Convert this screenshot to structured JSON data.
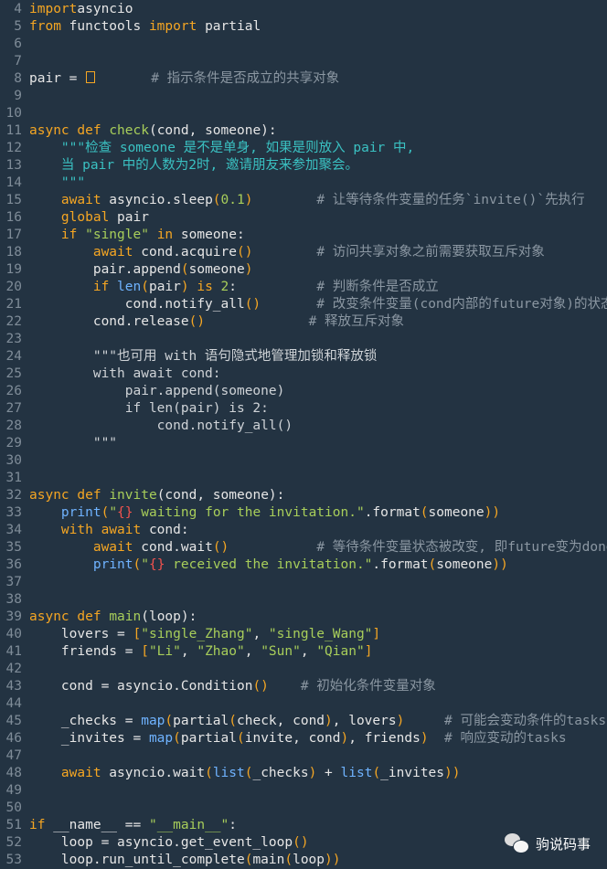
{
  "lines": [
    {
      "n": "4",
      "t": [
        [
          "kw",
          "import"
        ],
        [
          "",
          "asyncio"
        ]
      ],
      "sep": [
        0,
        " "
      ]
    },
    {
      "n": "5",
      "t": [
        [
          "kw",
          "from"
        ],
        [
          "",
          " functools "
        ],
        [
          "kw",
          "import"
        ],
        [
          "",
          " partial"
        ]
      ]
    },
    {
      "n": "6",
      "t": []
    },
    {
      "n": "7",
      "t": []
    },
    {
      "n": "8",
      "t": [
        [
          "",
          "pair = "
        ],
        [
          "box",
          ""
        ],
        [
          "",
          "       "
        ],
        [
          "cm",
          "# 指示条件是否成立的共享对象"
        ]
      ]
    },
    {
      "n": "9",
      "t": []
    },
    {
      "n": "10",
      "t": []
    },
    {
      "n": "11",
      "t": [
        [
          "kw",
          "async def "
        ],
        [
          "fn",
          "check"
        ],
        [
          "",
          "(cond, someone):"
        ]
      ]
    },
    {
      "n": "12",
      "t": [
        [
          "ds",
          "    \"\"\"检查 someone 是不是单身, 如果是则放入 pair 中,"
        ]
      ]
    },
    {
      "n": "13",
      "t": [
        [
          "ds",
          "    当 pair 中的人数为2时, 邀请朋友来参加聚会。"
        ]
      ]
    },
    {
      "n": "14",
      "t": [
        [
          "ds",
          "    \"\"\""
        ]
      ]
    },
    {
      "n": "15",
      "t": [
        [
          "kw",
          "    await"
        ],
        [
          "",
          " asyncio.sleep"
        ],
        [
          "pa",
          "("
        ],
        [
          "nm",
          "0.1"
        ],
        [
          "pa",
          ")"
        ],
        [
          "",
          "        "
        ],
        [
          "cm",
          "# 让等待条件变量的任务`invite()`先执行"
        ]
      ]
    },
    {
      "n": "16",
      "t": [
        [
          "kw",
          "    global"
        ],
        [
          "",
          " pair"
        ]
      ]
    },
    {
      "n": "17",
      "t": [
        [
          "kw",
          "    if"
        ],
        [
          "st",
          " \"single\""
        ],
        [
          "kw",
          " in"
        ],
        [
          "",
          " someone:"
        ]
      ]
    },
    {
      "n": "18",
      "t": [
        [
          "kw",
          "        await"
        ],
        [
          "",
          " cond.acquire"
        ],
        [
          "pa",
          "()"
        ],
        [
          "",
          "        "
        ],
        [
          "cm",
          "# 访问共享对象之前需要获取互斥对象"
        ]
      ]
    },
    {
      "n": "19",
      "t": [
        [
          "",
          "        pair.append"
        ],
        [
          "pa",
          "("
        ],
        [
          "",
          "someone"
        ],
        [
          "pa",
          ")"
        ]
      ]
    },
    {
      "n": "20",
      "t": [
        [
          "kw",
          "        if"
        ],
        [
          " call",
          " len"
        ],
        [
          "pa",
          "("
        ],
        [
          "",
          "pair"
        ],
        [
          "pa",
          ")"
        ],
        [
          "kw",
          " is"
        ],
        [
          "nm",
          " 2"
        ],
        [
          "",
          ":"
        ],
        [
          "",
          "          "
        ],
        [
          "cm",
          "# 判断条件是否成立"
        ]
      ]
    },
    {
      "n": "21",
      "t": [
        [
          "",
          "            cond.notify_all"
        ],
        [
          "pa",
          "()"
        ],
        [
          "",
          "       "
        ],
        [
          "cm",
          "# 改变条件变量(cond内部的future对象)的状态"
        ]
      ]
    },
    {
      "n": "22",
      "t": [
        [
          "",
          "        cond.release"
        ],
        [
          "pa",
          "()"
        ],
        [
          "",
          "             "
        ],
        [
          "cm",
          "# 释放互斥对象"
        ]
      ]
    },
    {
      "n": "23",
      "t": []
    },
    {
      "n": "24",
      "t": [
        [
          "db",
          "        \"\"\"也可用 with 语句隐式地管理加锁和释放锁"
        ]
      ]
    },
    {
      "n": "25",
      "t": [
        [
          "db",
          "        with await cond:"
        ]
      ]
    },
    {
      "n": "26",
      "t": [
        [
          "db",
          "            pair.append(someone)"
        ]
      ]
    },
    {
      "n": "27",
      "t": [
        [
          "db",
          "            if len(pair) is 2:"
        ]
      ]
    },
    {
      "n": "28",
      "t": [
        [
          "db",
          "                cond.notify_all()"
        ]
      ]
    },
    {
      "n": "29",
      "t": [
        [
          "db",
          "        \"\"\""
        ]
      ]
    },
    {
      "n": "30",
      "t": []
    },
    {
      "n": "31",
      "t": []
    },
    {
      "n": "32",
      "t": [
        [
          "kw",
          "async def "
        ],
        [
          "fn",
          "invite"
        ],
        [
          "",
          "(cond, someone):"
        ]
      ]
    },
    {
      "n": "33",
      "t": [
        [
          "call",
          "    print"
        ],
        [
          "pa",
          "("
        ],
        [
          "st",
          "\""
        ],
        [
          "sp",
          "{}"
        ],
        [
          "st",
          " waiting for the invitation.\""
        ],
        [
          "",
          ".format"
        ],
        [
          "pa",
          "("
        ],
        [
          "",
          "someone"
        ],
        [
          "pa",
          "))"
        ]
      ]
    },
    {
      "n": "34",
      "t": [
        [
          "kw",
          "    with await"
        ],
        [
          "",
          " cond:"
        ]
      ]
    },
    {
      "n": "35",
      "t": [
        [
          "kw",
          "        await"
        ],
        [
          "",
          " cond.wait"
        ],
        [
          "pa",
          "()"
        ],
        [
          "",
          "           "
        ],
        [
          "cm",
          "# 等待条件变量状态被改变, 即future变为done"
        ]
      ]
    },
    {
      "n": "36",
      "t": [
        [
          "call",
          "        print"
        ],
        [
          "pa",
          "("
        ],
        [
          "st",
          "\""
        ],
        [
          "sp",
          "{}"
        ],
        [
          "st",
          " received the invitation.\""
        ],
        [
          "",
          ".format"
        ],
        [
          "pa",
          "("
        ],
        [
          "",
          "someone"
        ],
        [
          "pa",
          "))"
        ]
      ]
    },
    {
      "n": "37",
      "t": []
    },
    {
      "n": "38",
      "t": []
    },
    {
      "n": "39",
      "t": [
        [
          "kw",
          "async def "
        ],
        [
          "fn",
          "main"
        ],
        [
          "",
          "(loop):"
        ]
      ]
    },
    {
      "n": "40",
      "t": [
        [
          "",
          "    lovers = "
        ],
        [
          "pa",
          "["
        ],
        [
          "st",
          "\"single_Zhang\""
        ],
        [
          "",
          ", "
        ],
        [
          "st",
          "\"single_Wang\""
        ],
        [
          "pa",
          "]"
        ]
      ]
    },
    {
      "n": "41",
      "t": [
        [
          "",
          "    friends = "
        ],
        [
          "pa",
          "["
        ],
        [
          "st",
          "\"Li\""
        ],
        [
          "",
          ", "
        ],
        [
          "st",
          "\"Zhao\""
        ],
        [
          "",
          ", "
        ],
        [
          "st",
          "\"Sun\""
        ],
        [
          "",
          ", "
        ],
        [
          "st",
          "\"Qian\""
        ],
        [
          "pa",
          "]"
        ]
      ]
    },
    {
      "n": "42",
      "t": []
    },
    {
      "n": "43",
      "t": [
        [
          "",
          "    cond = asyncio.Condition"
        ],
        [
          "pa",
          "()"
        ],
        [
          "",
          "    "
        ],
        [
          "cm",
          "# 初始化条件变量对象"
        ]
      ]
    },
    {
      "n": "44",
      "t": []
    },
    {
      "n": "45",
      "t": [
        [
          "",
          "    _checks = "
        ],
        [
          "call",
          "map"
        ],
        [
          "pa",
          "("
        ],
        [
          "",
          "partial"
        ],
        [
          "pa",
          "("
        ],
        [
          "",
          "check, cond"
        ],
        [
          "pa",
          ")"
        ],
        [
          "",
          ", lovers"
        ],
        [
          "pa",
          ")"
        ],
        [
          "",
          "     "
        ],
        [
          "cm",
          "# 可能会变动条件的tasks"
        ]
      ]
    },
    {
      "n": "46",
      "t": [
        [
          "",
          "    _invites = "
        ],
        [
          "call",
          "map"
        ],
        [
          "pa",
          "("
        ],
        [
          "",
          "partial"
        ],
        [
          "pa",
          "("
        ],
        [
          "",
          "invite, cond"
        ],
        [
          "pa",
          ")"
        ],
        [
          "",
          ", friends"
        ],
        [
          "pa",
          ")"
        ],
        [
          "",
          "  "
        ],
        [
          "cm",
          "# 响应变动的tasks"
        ]
      ]
    },
    {
      "n": "47",
      "t": []
    },
    {
      "n": "48",
      "t": [
        [
          "kw",
          "    await"
        ],
        [
          "",
          " asyncio.wait"
        ],
        [
          "pa",
          "("
        ],
        [
          "call",
          "list"
        ],
        [
          "pa",
          "("
        ],
        [
          "",
          "_checks"
        ],
        [
          "pa",
          ")"
        ],
        [
          "",
          " + "
        ],
        [
          "call",
          "list"
        ],
        [
          "pa",
          "("
        ],
        [
          "",
          "_invites"
        ],
        [
          "pa",
          "))"
        ]
      ]
    },
    {
      "n": "49",
      "t": []
    },
    {
      "n": "50",
      "t": []
    },
    {
      "n": "51",
      "t": [
        [
          "kw",
          "if"
        ],
        [
          "",
          " __name__ == "
        ],
        [
          "st",
          "\"__main__\""
        ],
        [
          "",
          ":"
        ]
      ]
    },
    {
      "n": "52",
      "t": [
        [
          "",
          "    loop = asyncio.get_event_loop"
        ],
        [
          "pa",
          "()"
        ]
      ]
    },
    {
      "n": "53",
      "t": [
        [
          "",
          "    loop.run_until_complete"
        ],
        [
          "pa",
          "("
        ],
        [
          "",
          "main"
        ],
        [
          "pa",
          "("
        ],
        [
          "",
          "loop"
        ],
        [
          "pa",
          "))"
        ]
      ]
    }
  ],
  "watermark": {
    "icon": "wechat-icon",
    "text": "驹说码事"
  }
}
